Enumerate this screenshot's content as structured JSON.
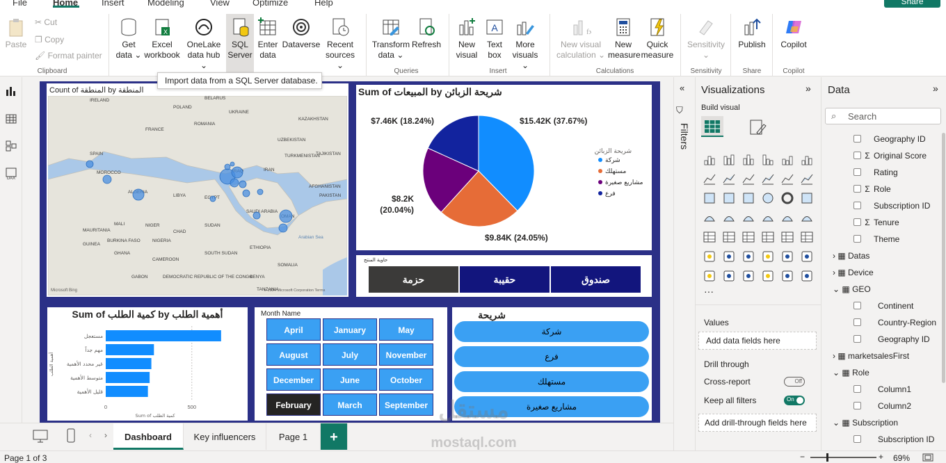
{
  "menu": {
    "file": "File",
    "home": "Home",
    "insert": "Insert",
    "modeling": "Modeling",
    "view": "View",
    "optimize": "Optimize",
    "help": "Help",
    "share": "Share"
  },
  "ribbon": {
    "paste": "Paste",
    "cut": "Cut",
    "copy": "Copy",
    "format_painter": "Format painter",
    "clipboard": "Clipboard",
    "get_data": "Get",
    "get_data2": "data ⌄",
    "excel": "Excel",
    "excel2": "workbook",
    "onelake": "OneLake",
    "onelake2": "data hub ⌄",
    "sql": "SQL",
    "sql2": "Server",
    "enter": "Enter",
    "enter2": "data",
    "dataverse": "Dataverse",
    "recent": "Recent",
    "recent2": "sources ⌄",
    "transform": "Transform",
    "transform2": "data ⌄",
    "refresh": "Refresh",
    "queries": "Queries",
    "new_visual": "New",
    "new_visual2": "visual",
    "text_box": "Text",
    "text_box2": "box",
    "more_visuals": "More",
    "more_visuals2": "visuals ⌄",
    "insert": "Insert",
    "new_calc": "New visual",
    "new_calc2": "calculation ⌄",
    "new_measure": "New",
    "new_measure2": "measure",
    "quick_measure": "Quick",
    "quick_measure2": "measure",
    "calculations": "Calculations",
    "sensitivity": "Sensitivity",
    "sensitivity2": "⌄",
    "sensitivity_grp": "Sensitivity",
    "publish": "Publish",
    "share_grp": "Share",
    "copilot": "Copilot",
    "copilot_grp": "Copilot"
  },
  "tooltip": "Import data from a SQL Server database.",
  "map_card": {
    "title": "Count of المنطقة by المنطقة",
    "labels": [
      "IRELAND",
      "BELARUS",
      "POLAND",
      "UKRAINE",
      "KAZAKHSTAN",
      "FRANCE",
      "ROMANIA",
      "UZBEKISTAN",
      "SPAIN",
      "TURKMENISTAN",
      "TAJIKISTAN",
      "MOROCCO",
      "IRAN",
      "ALGERIA",
      "LIBYA",
      "EGYPT",
      "AFGHANISTAN",
      "PAKISTAN",
      "SAUDI ARABIA",
      "OMAN",
      "MAURITANIA",
      "MALI",
      "NIGER",
      "CHAD",
      "SUDAN",
      "BURKINA FASO",
      "GUINEA",
      "NIGERIA",
      "ETHIOPIA",
      "GHANA",
      "CAMEROON",
      "SOUTH SUDAN",
      "SOMALIA",
      "GABON",
      "DEMOCRATIC REPUBLIC OF THE CONGO",
      "KENYA",
      "TANZANIA",
      "IRAQ",
      "Arabian Sea"
    ],
    "footer_left": "Microsoft Bing",
    "footer_right": "© 2024 Microsoft Corporation  Terms"
  },
  "pie_card": {
    "title": "Sum of المبيعات by شريحة الزبائن",
    "legend_title": "شريحة الزبائن",
    "legend": [
      "شركة",
      "مستهلك",
      "مشاريع صغيرة",
      "فرع"
    ],
    "colors": {
      "company": "#118dff",
      "consumer": "#e66c37",
      "small": "#6b007b",
      "branch": "#12239e"
    }
  },
  "chart_data": [
    {
      "type": "pie",
      "title": "Sum of المبيعات by شريحة الزبائن",
      "categories": [
        "شركة",
        "مستهلك",
        "مشاريع صغيرة",
        "فرع"
      ],
      "values": [
        15.42,
        9.84,
        8.2,
        7.46
      ],
      "labels": [
        "$15.42K (37.67%)",
        "$9.84K (24.05%)",
        "$8.2K",
        "(20.04%)",
        "$7.46K (18.24%)"
      ],
      "legend": "right"
    },
    {
      "type": "bar",
      "title": "Sum of كمية الطلب by أهمية الطلب",
      "categories": [
        "مستعجل",
        "مهم جداً",
        "غير محدد الأهمية",
        "متوسط الأهمية",
        "قليل الأهمية"
      ],
      "values": [
        670,
        280,
        265,
        255,
        245
      ],
      "xlabel": "Sum of كمية الطلب",
      "ylabel": "أهمية الطلب",
      "xticks": [
        "0",
        "500"
      ],
      "xlim": [
        0,
        800
      ]
    }
  ],
  "product_card": {
    "title": "حاوية المنتج",
    "buttons": [
      "حزمة",
      "حقيبة",
      "صندوق"
    ]
  },
  "month_card": {
    "title": "Month Name",
    "months": [
      "April",
      "January",
      "May",
      "August",
      "July",
      "November",
      "December",
      "June",
      "October",
      "February",
      "March",
      "September"
    ],
    "selected": "February"
  },
  "segment_card": {
    "title": "شريحة الزبائن",
    "items": [
      "شركة",
      "فرع",
      "مستهلك",
      "مشاريع صغيرة"
    ]
  },
  "filters": {
    "label": "Filters"
  },
  "viz": {
    "title": "Visualizations",
    "build": "Build visual",
    "values": "Values",
    "add_fields": "Add data fields here",
    "drill": "Drill through",
    "cross": "Cross-report",
    "off": "Off",
    "keep": "Keep all filters",
    "on": "On",
    "add_drill": "Add drill-through fields here",
    "more": "···"
  },
  "data": {
    "title": "Data",
    "search": "Search",
    "rows": [
      {
        "label": "Geography ID",
        "sigma": false
      },
      {
        "label": "Original Score",
        "sigma": true
      },
      {
        "label": "Rating",
        "sigma": false
      },
      {
        "label": "Role",
        "sigma": true
      },
      {
        "label": "Subscription ID",
        "sigma": false
      },
      {
        "label": "Tenure",
        "sigma": true
      },
      {
        "label": "Theme",
        "sigma": false
      }
    ],
    "tables": {
      "datas": "Datas",
      "device": "Device",
      "geo": "GEO",
      "market": "marketsalesFirst",
      "role": "Role",
      "subscription": "Subscription"
    },
    "geo_rows": [
      "Continent",
      "Country-Region",
      "Geography ID"
    ],
    "role_rows": [
      "Column1",
      "Column2"
    ],
    "sub_rows": [
      "Subscription ID"
    ]
  },
  "pages": {
    "dashboard": "Dashboard",
    "key": "Key influencers",
    "page1": "Page 1",
    "add": "+"
  },
  "status": {
    "page": "Page 1 of 3",
    "zoom": "69%"
  },
  "watermark": {
    "text": "مستقل",
    "sub": "mostaql.com"
  }
}
